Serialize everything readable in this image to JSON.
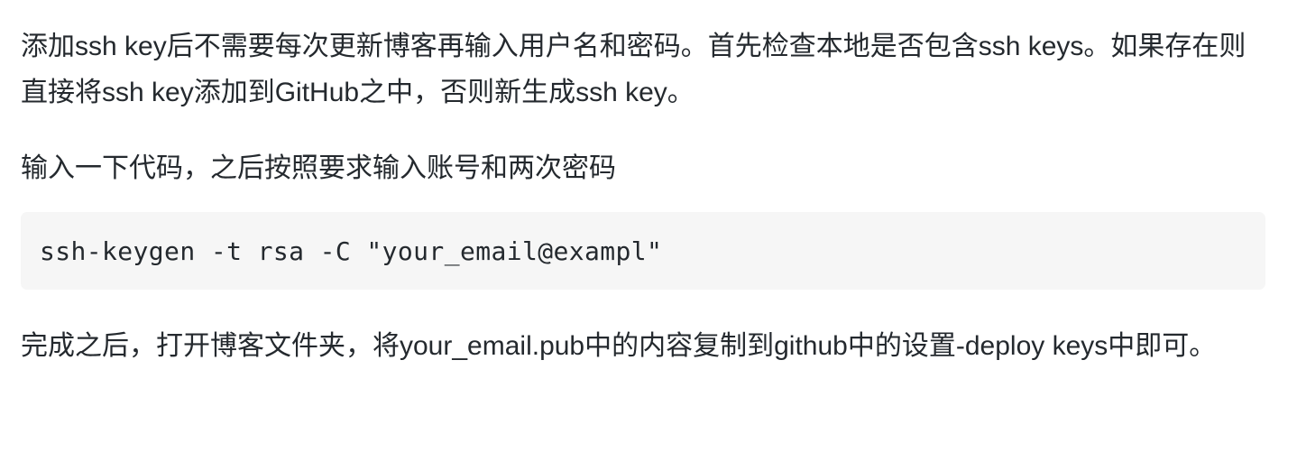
{
  "article": {
    "paragraph_1": "添加ssh key后不需要每次更新博客再输入用户名和密码。首先检查本地是否包含ssh keys。如果存在则直接将ssh key添加到GitHub之中，否则新生成ssh key。",
    "paragraph_2": "输入一下代码，之后按照要求输入账号和两次密码",
    "code": "ssh-keygen -t rsa -C \"your_email@exampl\"",
    "paragraph_3": "完成之后，打开博客文件夹，将your_email.pub中的内容复制到github中的设置-deploy keys中即可。"
  }
}
